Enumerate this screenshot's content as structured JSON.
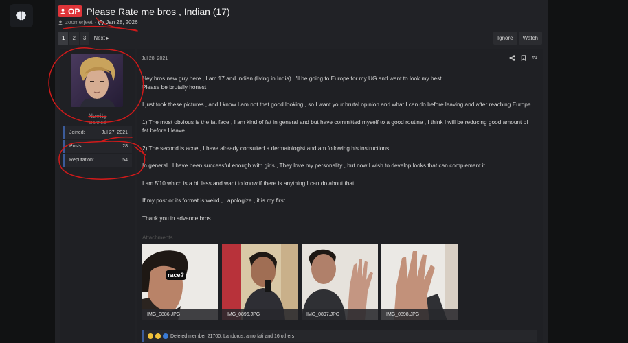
{
  "app": {
    "logo_icon": "brain-icon"
  },
  "thread": {
    "op_badge": "OP",
    "title": "Please Rate me bros , Indian (17)",
    "author": "zoomerjeet",
    "separator": "·",
    "date": "Jan 28, 2026"
  },
  "pagination": {
    "pages": [
      "1",
      "2",
      "3"
    ],
    "current": "1",
    "next_label": "Next"
  },
  "thread_actions": {
    "ignore_label": "Ignore",
    "watch_label": "Watch"
  },
  "user": {
    "name": "Navity",
    "role": "Banned",
    "joined_label": "Joined:",
    "joined_value": "Jul 27, 2021",
    "posts_label": "Posts:",
    "posts_value": "28",
    "reputation_label": "Reputation:",
    "reputation_value": "54"
  },
  "post": {
    "date": "Jul 28, 2021",
    "number": "#1",
    "paragraphs": [
      "Hey bros new guy here , I am 17 and Indian (living in India). I'll be going to Europe for my UG and want to look my best.\nPlease be brutally honest",
      "I just took these pictures , and I know I am not that good looking , so I want your brutal opinion and what I can do before leaving and after reaching Europe.",
      "1) The most obvious is the fat face , I am kind of fat in general and but have committed myself to a good routine , I think I will be reducing good amount of fat before I leave.",
      "2) The second is acne , I have already consulted a dermatologist and am following his instructions.",
      "In general , I have been successful enough with girls , They love my personality , but now I wish to develop looks that can complement it.",
      "I am 5'10 which is a bit less and want to know if there is anything I can do about that.",
      "If my post or its format is weird , I apologize , it is my first.",
      "Thank you in advance bros."
    ],
    "attachments_label": "Attachments",
    "attachments": [
      {
        "filename": "IMG_0886.JPG",
        "overlay_text": "race?"
      },
      {
        "filename": "IMG_0896.JPG"
      },
      {
        "filename": "IMG_0897.JPG"
      },
      {
        "filename": "IMG_0898.JPG"
      }
    ],
    "reactions_text": "Deleted member 21700, Landorus, amorfati and 16 others"
  },
  "colors": {
    "accent": "#3b5b9a",
    "op_badge": "#e0353a",
    "annotation_red": "#d11a1a"
  }
}
